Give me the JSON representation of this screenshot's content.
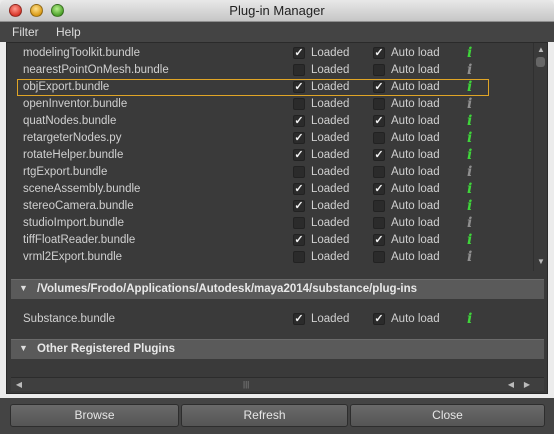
{
  "window": {
    "title": "Plug-in Manager"
  },
  "menu": [
    "Filter",
    "Help"
  ],
  "labels": {
    "loaded": "Loaded",
    "auto_load": "Auto load",
    "info_glyph": "i"
  },
  "plugins": [
    {
      "name": "modelingToolkit.bundle",
      "loaded": true,
      "auto": true,
      "selected": false
    },
    {
      "name": "nearestPointOnMesh.bundle",
      "loaded": false,
      "auto": false,
      "selected": false
    },
    {
      "name": "objExport.bundle",
      "loaded": true,
      "auto": true,
      "selected": true
    },
    {
      "name": "openInventor.bundle",
      "loaded": false,
      "auto": false,
      "selected": false
    },
    {
      "name": "quatNodes.bundle",
      "loaded": true,
      "auto": true,
      "selected": false
    },
    {
      "name": "retargeterNodes.py",
      "loaded": true,
      "auto": false,
      "selected": false
    },
    {
      "name": "rotateHelper.bundle",
      "loaded": true,
      "auto": true,
      "selected": false
    },
    {
      "name": "rtgExport.bundle",
      "loaded": false,
      "auto": false,
      "selected": false
    },
    {
      "name": "sceneAssembly.bundle",
      "loaded": true,
      "auto": true,
      "selected": false
    },
    {
      "name": "stereoCamera.bundle",
      "loaded": true,
      "auto": false,
      "selected": false
    },
    {
      "name": "studioImport.bundle",
      "loaded": false,
      "auto": false,
      "selected": false
    },
    {
      "name": "tiffFloatReader.bundle",
      "loaded": true,
      "auto": true,
      "selected": false
    },
    {
      "name": "vrml2Export.bundle",
      "loaded": false,
      "auto": false,
      "selected": false
    }
  ],
  "substance_section": {
    "path": "/Volumes/Frodo/Applications/Autodesk/maya2014/substance/plug-ins",
    "plugins": [
      {
        "name": "Substance.bundle",
        "loaded": true,
        "auto": true
      }
    ]
  },
  "other_section": {
    "title": "Other Registered Plugins"
  },
  "buttons": {
    "browse": "Browse",
    "refresh": "Refresh",
    "close": "Close"
  },
  "colors": {
    "info_loaded": "#3fd43a",
    "info_unloaded": "#8f8f8f",
    "selection": "#e0a526"
  }
}
